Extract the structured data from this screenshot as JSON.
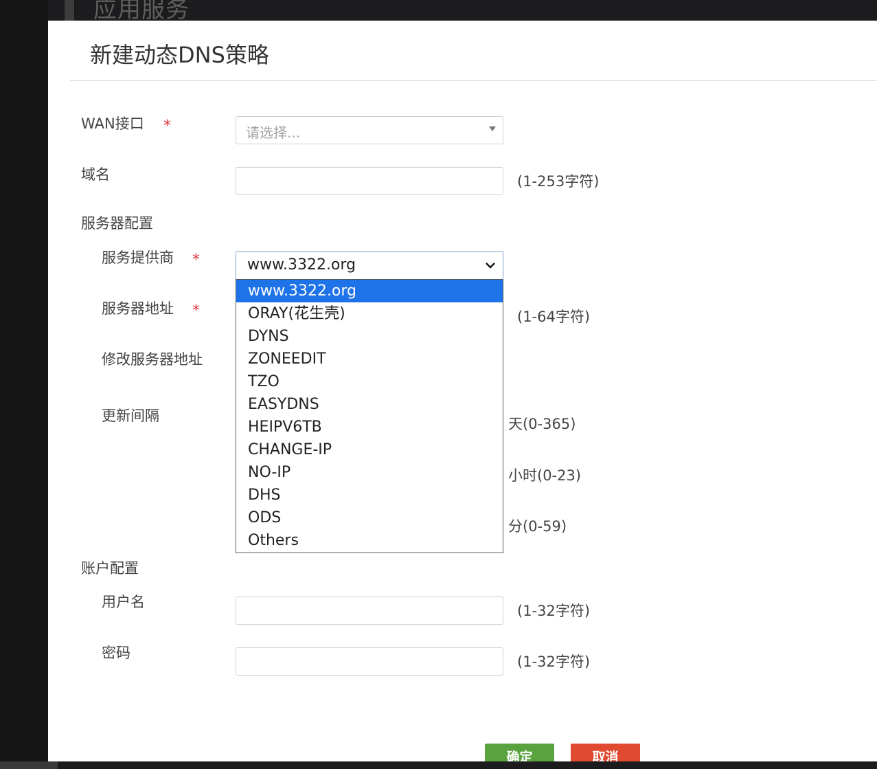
{
  "background": {
    "title": "应用服务"
  },
  "dialog": {
    "title": "新建动态DNS策略"
  },
  "form": {
    "wan": {
      "label": "WAN接口",
      "required_mark": "*",
      "placeholder": "请选择..."
    },
    "domain": {
      "label": "域名",
      "hint": "(1-253字符)"
    },
    "server_section": {
      "label": "服务器配置"
    },
    "provider": {
      "label": "服务提供商",
      "required_mark": "*",
      "value": "www.3322.org"
    },
    "server_addr": {
      "label": "服务器地址",
      "required_mark": "*",
      "hint": "(1-64字符)"
    },
    "modify_addr": {
      "label": "修改服务器地址"
    },
    "interval": {
      "label": "更新间隔",
      "days_hint": "天(0-365)",
      "hours_hint": "小时(0-23)",
      "minutes_hint": "分(0-59)"
    },
    "account_section": {
      "label": "账户配置"
    },
    "username": {
      "label": "用户名",
      "hint": "(1-32字符)"
    },
    "password": {
      "label": "密码",
      "hint": "(1-32字符)"
    }
  },
  "dropdown": {
    "options": [
      "www.3322.org",
      "ORAY(花生壳)",
      "DYNS",
      "ZONEEDIT",
      "TZO",
      "EASYDNS",
      "HEIPV6TB",
      "CHANGE-IP",
      "NO-IP",
      "DHS",
      "ODS",
      "Others"
    ],
    "selected": "www.3322.org"
  },
  "buttons": {
    "ok": "确定",
    "cancel": "取消"
  },
  "colors": {
    "required": "#e0303a",
    "selected_option": "#1e73e8",
    "ok_button": "#5aa23e",
    "cancel_button": "#e04a31"
  }
}
